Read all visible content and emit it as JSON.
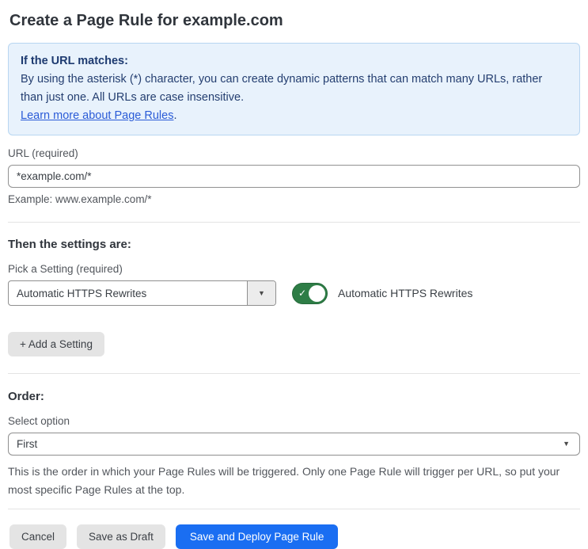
{
  "page": {
    "title": "Create a Page Rule for example.com"
  },
  "callout": {
    "heading": "If the URL matches:",
    "body": "By using the asterisk (*) character, you can create dynamic patterns that can match many URLs, rather than just one. All URLs are case insensitive.",
    "link_label": "Learn more about Page Rules",
    "link_suffix": "."
  },
  "url_field": {
    "label": "URL (required)",
    "value": "*example.com/*",
    "help": "Example: www.example.com/*"
  },
  "settings_section": {
    "heading": "Then the settings are:",
    "picker_label": "Pick a Setting (required)",
    "selected_setting": "Automatic HTTPS Rewrites",
    "dropdown_caret": "▼",
    "toggle_state": "on",
    "toggle_check": "✓",
    "toggle_label": "Automatic HTTPS Rewrites",
    "add_setting_label": "+ Add a Setting"
  },
  "order_section": {
    "heading": "Order:",
    "select_label": "Select option",
    "selected_option": "First",
    "dropdown_caret": "▼",
    "help": "This is the order in which your Page Rules will be triggered. Only one Page Rule will trigger per URL, so put your most specific Page Rules at the top."
  },
  "footer": {
    "cancel_label": "Cancel",
    "save_draft_label": "Save as Draft",
    "save_deploy_label": "Save and Deploy Page Rule"
  },
  "colors": {
    "callout_bg": "#e8f2fc",
    "callout_border": "#b8d6f1",
    "callout_text": "#243e70",
    "link": "#2a5bd7",
    "toggle_on_green": "#2e7d46",
    "primary_button_blue": "#1a6ef2",
    "secondary_button_gray": "#e4e4e4",
    "input_border": "#919191",
    "divider": "#e4e4e4"
  }
}
